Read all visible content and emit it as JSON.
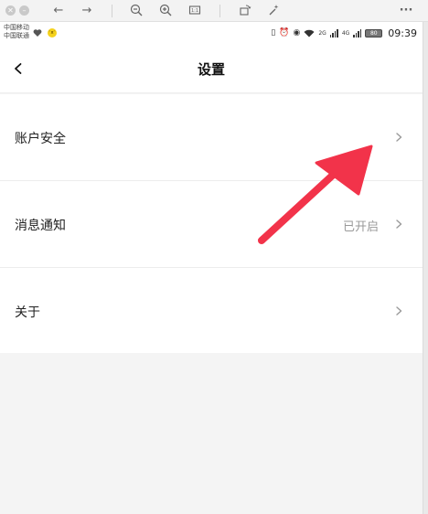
{
  "status_bar": {
    "carrier_1": "中国移动",
    "carrier_2": "中国联通",
    "network_1": "2G",
    "network_2": "4G",
    "battery": "80",
    "time": "09:39"
  },
  "header": {
    "title": "设置"
  },
  "settings_items": [
    {
      "label": "账户安全",
      "value": ""
    },
    {
      "label": "消息通知",
      "value": "已开启"
    },
    {
      "label": "关于",
      "value": ""
    }
  ],
  "colors": {
    "arrow": "#f2334a",
    "background": "#f4f4f4",
    "secondary_text": "#999999"
  },
  "icons": {
    "toolbar": [
      "close-icon",
      "minimize-icon",
      "back-arrow-icon",
      "forward-arrow-icon",
      "zoom-out-icon",
      "zoom-in-icon",
      "fit-screen-icon",
      "rotate-icon",
      "magic-wand-icon",
      "more-icon"
    ]
  }
}
